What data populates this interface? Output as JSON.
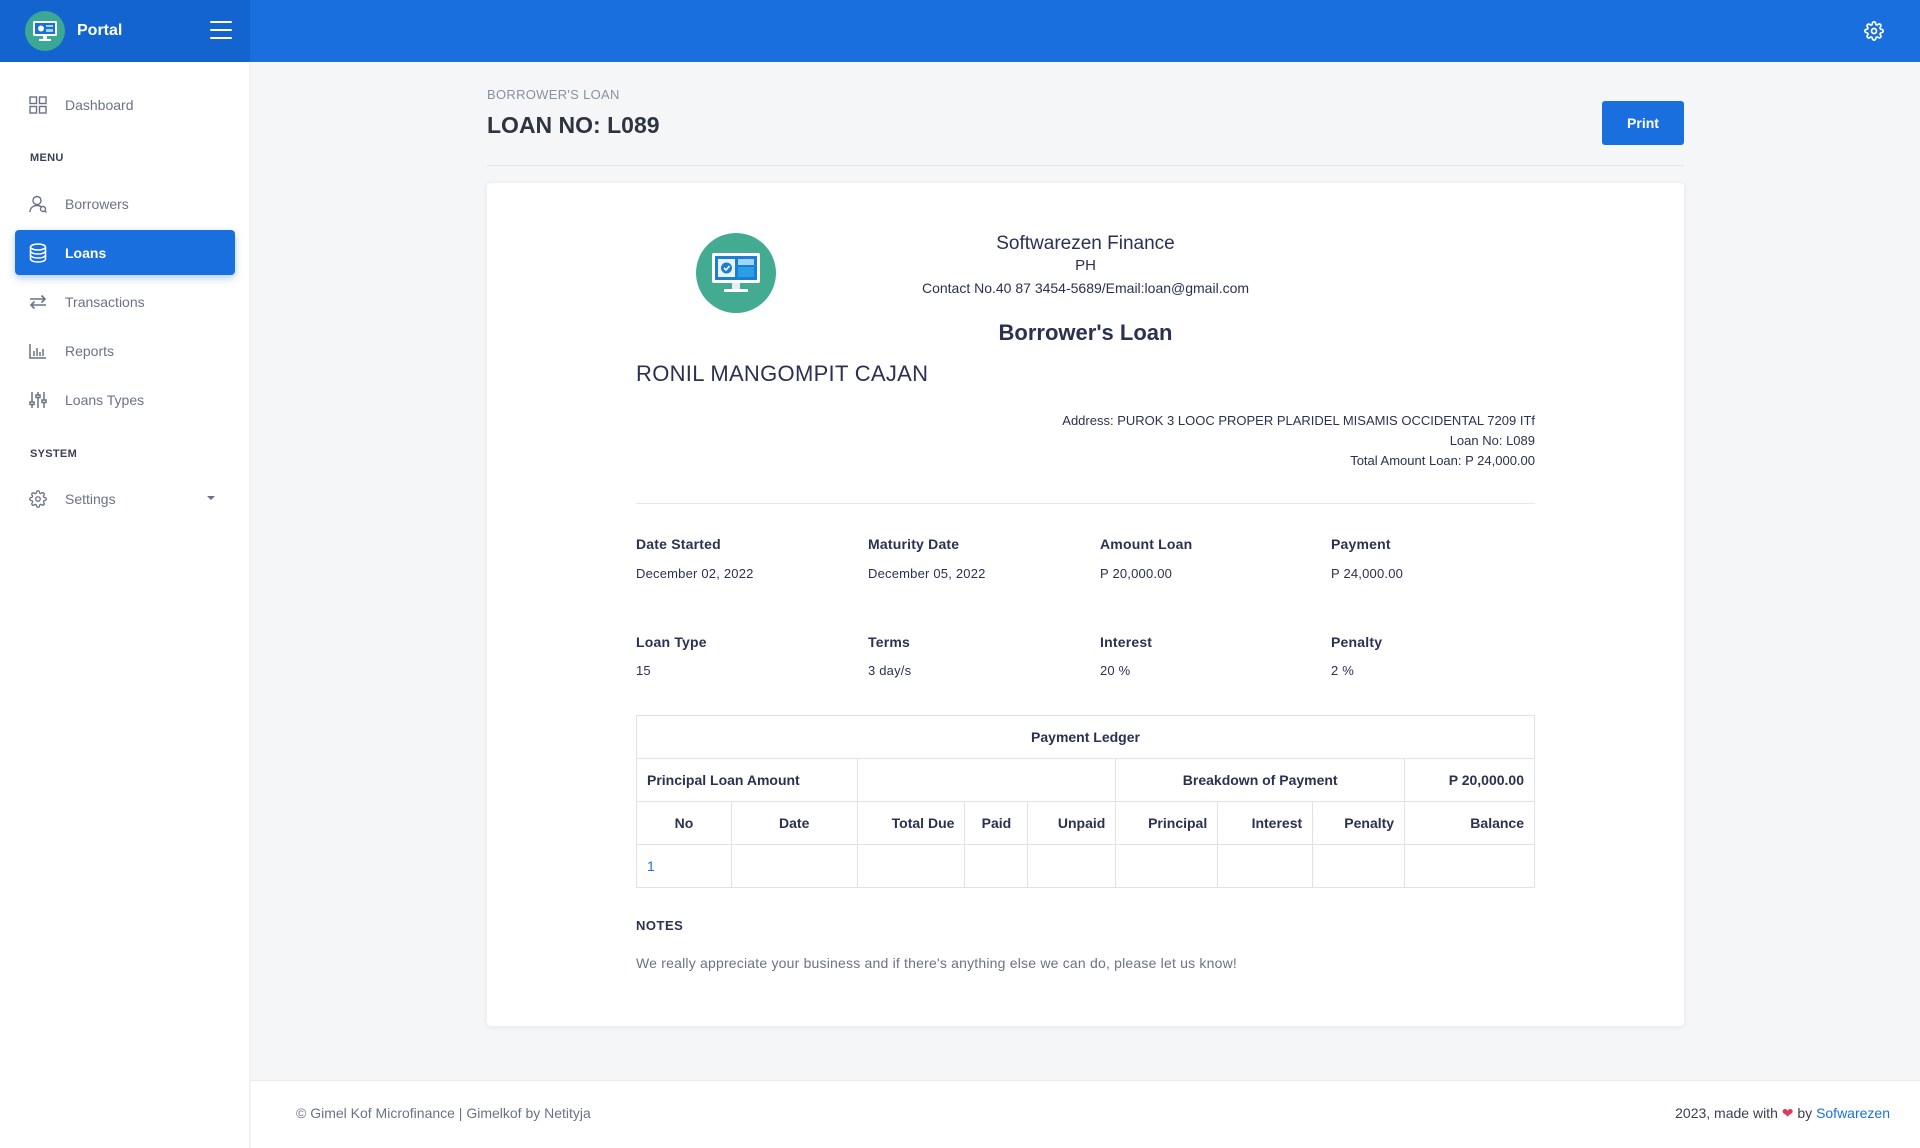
{
  "brand": {
    "name": "Portal"
  },
  "sidebar": {
    "items": [
      {
        "label": "Dashboard"
      },
      {
        "label": "Borrowers"
      },
      {
        "label": "Loans"
      },
      {
        "label": "Transactions"
      },
      {
        "label": "Reports"
      },
      {
        "label": "Loans Types"
      },
      {
        "label": "Settings"
      }
    ],
    "sections": {
      "menu": "MENU",
      "system": "SYSTEM"
    }
  },
  "header": {
    "breadcrumb": "BORROWER'S LOAN",
    "title": "LOAN NO: L089",
    "print_label": "Print"
  },
  "company": {
    "name": "Softwarezen Finance",
    "country": "PH",
    "contact": "Contact No.40 87 3454-5689/Email:loan@gmail.com"
  },
  "document": {
    "title": "Borrower's Loan",
    "borrower_name": "RONIL MANGOMPIT CAJAN",
    "address": "Address: PUROK 3 LOOC PROPER PLARIDEL MISAMIS OCCIDENTAL 7209 ITf",
    "loan_no": "Loan No: L089",
    "total_amount": "Total Amount Loan: P 24,000.00"
  },
  "info": {
    "date_started": {
      "label": "Date Started",
      "value": "December 02, 2022"
    },
    "maturity_date": {
      "label": "Maturity Date",
      "value": "December 05, 2022"
    },
    "amount_loan": {
      "label": "Amount Loan",
      "value": "P 20,000.00"
    },
    "payment": {
      "label": "Payment",
      "value": "P 24,000.00"
    },
    "loan_type": {
      "label": "Loan Type",
      "value": "15"
    },
    "terms": {
      "label": "Terms",
      "value": "3 day/s"
    },
    "interest": {
      "label": "Interest",
      "value": "20 %"
    },
    "penalty": {
      "label": "Penalty",
      "value": "2 %"
    }
  },
  "ledger": {
    "title": "Payment Ledger",
    "principal_label": "Principal Loan Amount",
    "breakdown_label": "Breakdown of Payment",
    "principal_value": "P 20,000.00",
    "columns": [
      "No",
      "Date",
      "Total Due",
      "Paid",
      "Unpaid",
      "Principal",
      "Interest",
      "Penalty",
      "Balance"
    ],
    "rows": [
      [
        "1",
        "",
        "",
        "",
        "",
        "",
        "",
        "",
        ""
      ]
    ]
  },
  "notes": {
    "title": "NOTES",
    "text": "We really appreciate your business and if there's anything else we can do, please let us know!"
  },
  "footer": {
    "left": "© Gimel Kof Microfinance | Gimelkof by Netityja",
    "right_prefix": "2023, made with",
    "heart": "❤",
    "right_by": "by",
    "right_link": "Sofwarezen"
  },
  "colors": {
    "primary": "#1a6fdf",
    "logo_green": "#43ab92",
    "heart": "#e0395b"
  },
  "icons": {
    "sidebar": [
      "dashboard-icon",
      "borrowers-icon",
      "loans-icon",
      "transactions-icon",
      "reports-icon",
      "loan-types-icon",
      "settings-icon"
    ],
    "top": [
      "menu-icon",
      "gear-icon"
    ]
  }
}
